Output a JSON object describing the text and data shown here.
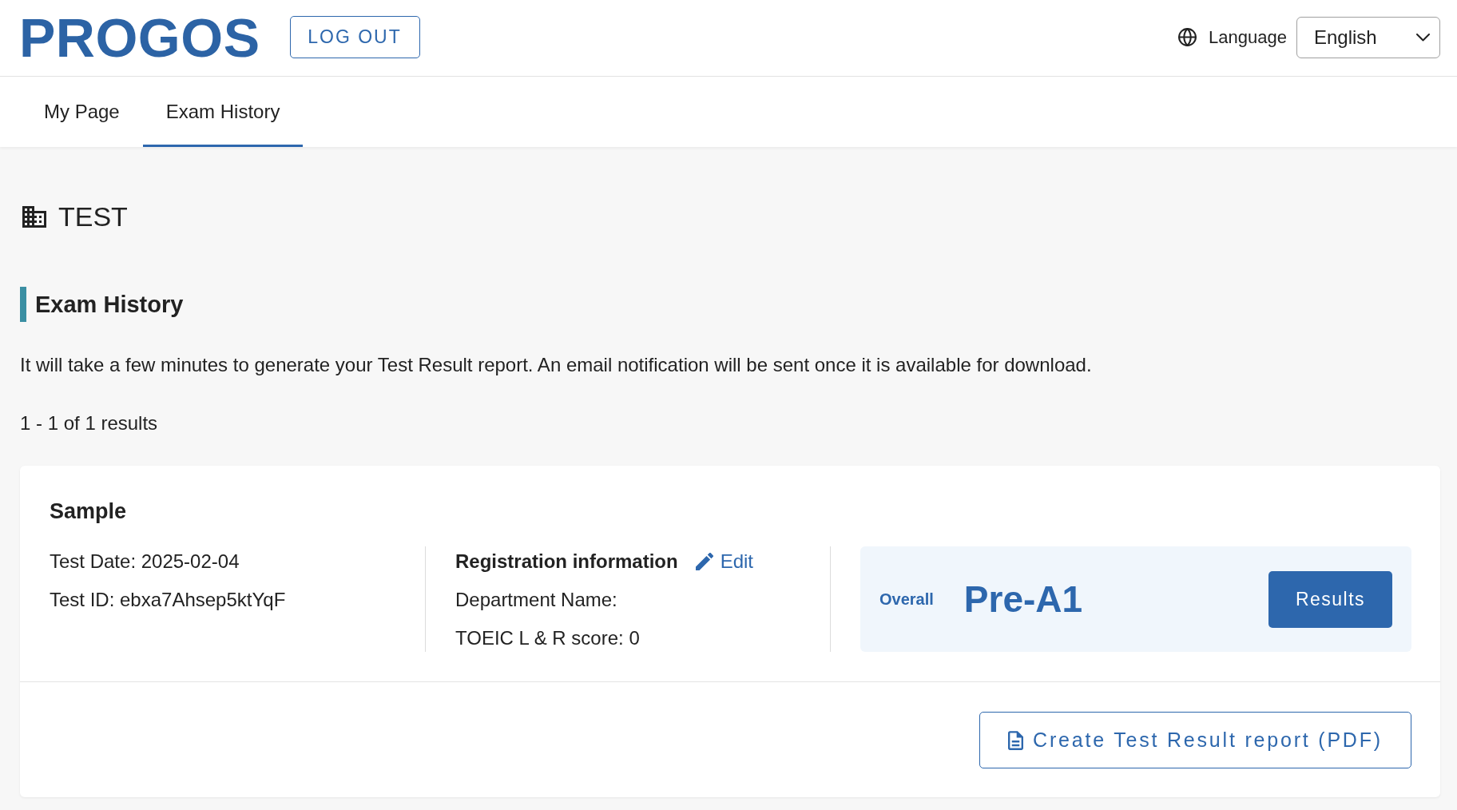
{
  "header": {
    "logo": "PROGOS",
    "logout_button": "LOG OUT",
    "language_label": "Language",
    "language_select": {
      "value": "English"
    }
  },
  "tabs": [
    {
      "label": "My Page",
      "selected": false
    },
    {
      "label": "Exam History",
      "selected": true
    }
  ],
  "organization": {
    "name": "TEST"
  },
  "section": {
    "title": "Exam History",
    "notice": "It will take a few minutes to generate your Test Result report. An email notification will be sent once it is available for download.",
    "result_count": "1 - 1 of 1 results"
  },
  "results": [
    {
      "name": "Sample",
      "details": [
        "Test Date: 2025-02-04",
        "Test ID: ebxa7Ahsep5ktYqF"
      ],
      "registration": {
        "title": "Registration information",
        "edit_link": "Edit",
        "fields": [
          "Department Name:",
          "TOEIC L & R score: 0"
        ]
      },
      "overall_label": "Overall",
      "overall_level": "Pre-A1",
      "results_button": "Results",
      "report_button": "Create Test Result report (PDF)"
    }
  ]
}
